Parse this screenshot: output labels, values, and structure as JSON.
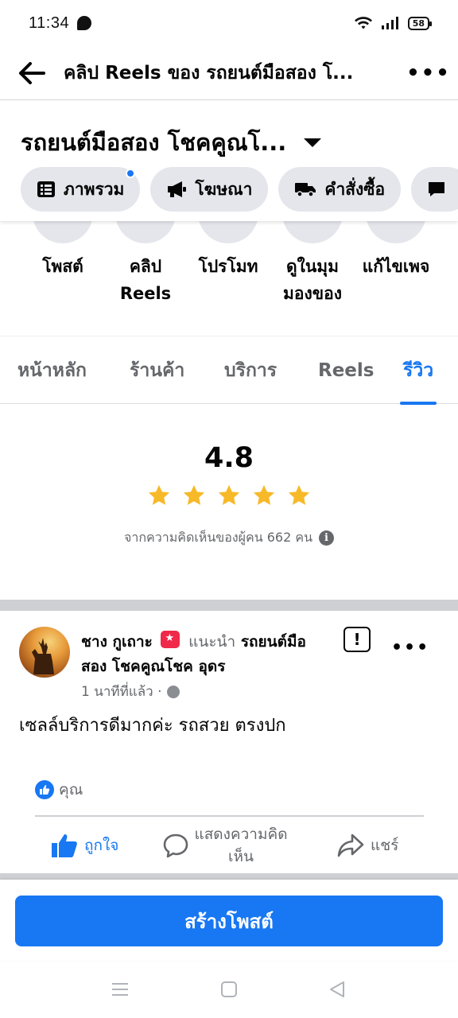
{
  "status_bar": {
    "time": "11:34",
    "battery": "58"
  },
  "top_bar": {
    "title": "คลิป Reels ของ รถยนต์มือสอง โ..."
  },
  "page": {
    "name": "รถยนต์มือสอง โชคคูณโ..."
  },
  "pills": [
    {
      "label": "ภาพรวม",
      "icon": "list-icon",
      "has_dot": true
    },
    {
      "label": "โฆษณา",
      "icon": "megaphone-icon"
    },
    {
      "label": "คำสั่งซื้อ",
      "icon": "truck-icon"
    }
  ],
  "actions": [
    {
      "label_1": "โพสต์",
      "label_2": ""
    },
    {
      "label_1": "คลิป",
      "label_2": "Reels"
    },
    {
      "label_1": "โปรโมท",
      "label_2": ""
    },
    {
      "label_1": "ดูในมุม",
      "label_2": "มองของ"
    },
    {
      "label_1": "แก้ไขเพจ",
      "label_2": ""
    }
  ],
  "tabs": [
    {
      "label": "หน้าหลัก"
    },
    {
      "label": "ร้านค้า"
    },
    {
      "label": "บริการ"
    },
    {
      "label": "Reels"
    },
    {
      "label": "รีวิว",
      "active": true
    }
  ],
  "rating": {
    "value": "4.8",
    "stars": 5,
    "count_text": "จากความคิดเห็นของผู้คน 662 คน"
  },
  "review": {
    "author": "ชาง กูเถาะ",
    "recommends": "แนะนำ",
    "page_name": "รถยนต์มือสอง โชคคูณโชค อุดร",
    "time": "1 นาทีที่แล้ว ·",
    "text": "เซลล์บริการดีมากค่ะ รถสวย ตรงปก",
    "likes_text": "คุณ",
    "like_label": "ถูกใจ",
    "comment_label_1": "แสดงความคิด",
    "comment_label_2": "เห็น",
    "share_label": "แชร์"
  },
  "bottom": {
    "create_post": "สร้างโพสต์"
  },
  "colors": {
    "accent": "#1877f2",
    "star": "#f7b928",
    "pill_bg": "#e4e6eb",
    "muted": "#65676b"
  }
}
